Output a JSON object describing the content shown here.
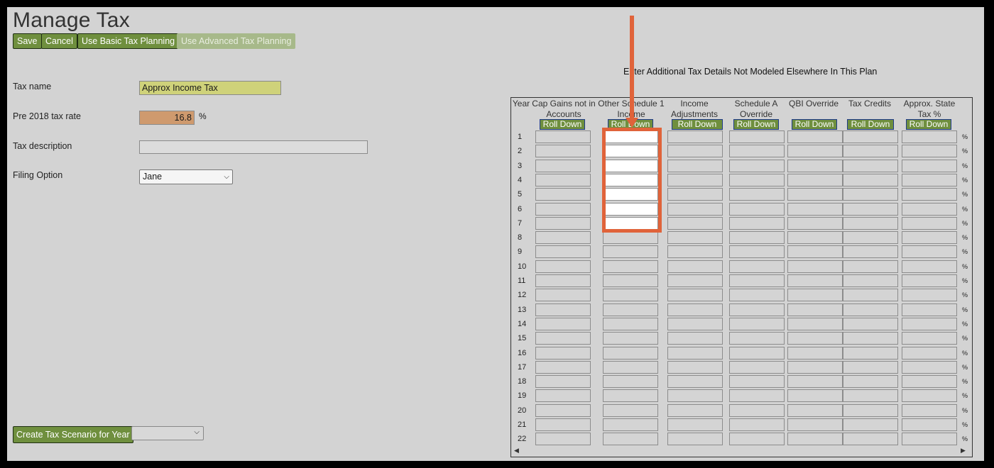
{
  "title": "Manage Tax",
  "toolbar": {
    "save": "Save",
    "cancel": "Cancel",
    "basic": "Use Basic Tax Planning",
    "advanced": "Use Advanced Tax Planning"
  },
  "form": {
    "tax_name_label": "Tax name",
    "tax_name_value": "Approx Income Tax",
    "rate_label": "Pre 2018 tax rate",
    "rate_value": "16.8",
    "rate_unit": "%",
    "description_label": "Tax description",
    "description_value": "",
    "filing_label": "Filing Option",
    "filing_value": "Jane"
  },
  "scenario_button": "Create Tax Scenario for Year",
  "scenario_select_value": "",
  "panel": {
    "heading": "Enter Additional Tax Details Not Modeled Elsewhere In This Plan",
    "year_header": "Year",
    "columns": [
      {
        "label": "Cap Gains not in Accounts",
        "roll": "Roll Down"
      },
      {
        "label": "Other Schedule 1 Income",
        "roll": "Roll Down"
      },
      {
        "label": "Income Adjustments",
        "roll": "Roll Down"
      },
      {
        "label": "Schedule A Override",
        "roll": "Roll Down"
      },
      {
        "label": "QBI Override",
        "roll": "Roll Down"
      },
      {
        "label": "Tax Credits",
        "roll": "Roll Down"
      },
      {
        "label": "Approx. State Tax %",
        "roll": "Roll Down"
      }
    ],
    "rows": [
      "1",
      "2",
      "3",
      "4",
      "5",
      "6",
      "7",
      "8",
      "9",
      "10",
      "11",
      "12",
      "13",
      "14",
      "15",
      "16",
      "17",
      "18",
      "19",
      "20",
      "21",
      "22"
    ],
    "row_suffix": "%"
  },
  "accent_colors": {
    "button_green": "#6f8f3e",
    "annotation_orange": "#e0633a",
    "name_field": "#cfd27a",
    "rate_field": "#cf9a6e"
  }
}
